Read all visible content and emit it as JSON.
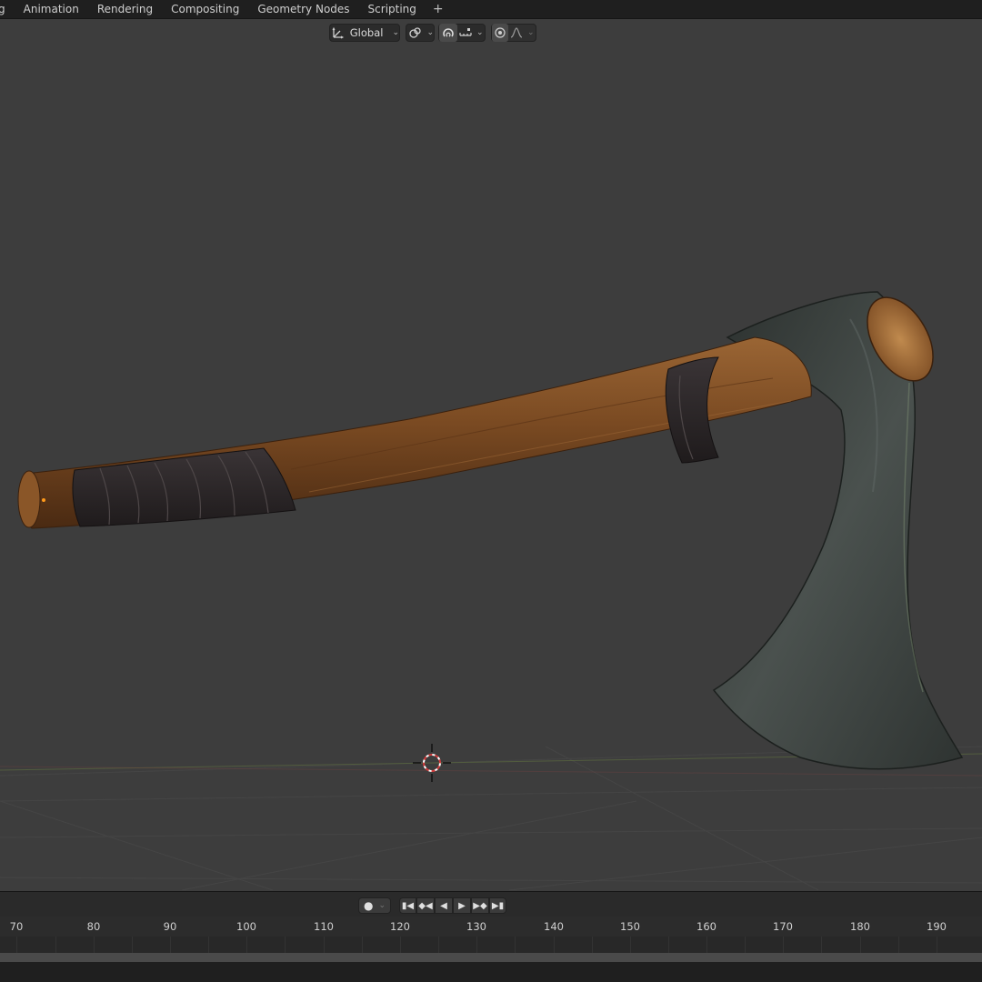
{
  "workspace_tabs": {
    "partial": "g",
    "animation": "Animation",
    "rendering": "Rendering",
    "compositing": "Compositing",
    "geometry_nodes": "Geometry Nodes",
    "scripting": "Scripting",
    "add": "+"
  },
  "header": {
    "transform_orientation": "Global"
  },
  "timeline": {
    "frame_ticks": [
      "70",
      "80",
      "90",
      "100",
      "110",
      "120",
      "130",
      "140",
      "150",
      "160",
      "170",
      "180",
      "190"
    ]
  },
  "colors": {
    "viewport_bg": "#3d3d3d",
    "topbar_bg": "#1f1f1f",
    "wood": "#7a4a22",
    "wrap": "#2a2526",
    "blade": "#3f4543"
  },
  "icons": {
    "orientation": "transform-orientation-icon",
    "pivot": "pivot-link-icon",
    "snap": "snap-magnet-icon",
    "snap_target": "snap-increment-icon",
    "proportional": "proportional-edit-icon",
    "falloff": "falloff-curve-icon",
    "record": "record-icon",
    "jump_start": "jump-start-icon",
    "prev_key": "prev-keyframe-icon",
    "play_reverse": "play-reverse-icon",
    "play": "play-icon",
    "next_key": "next-keyframe-icon",
    "jump_end": "jump-end-icon",
    "cursor_3d": "3d-cursor-icon"
  }
}
